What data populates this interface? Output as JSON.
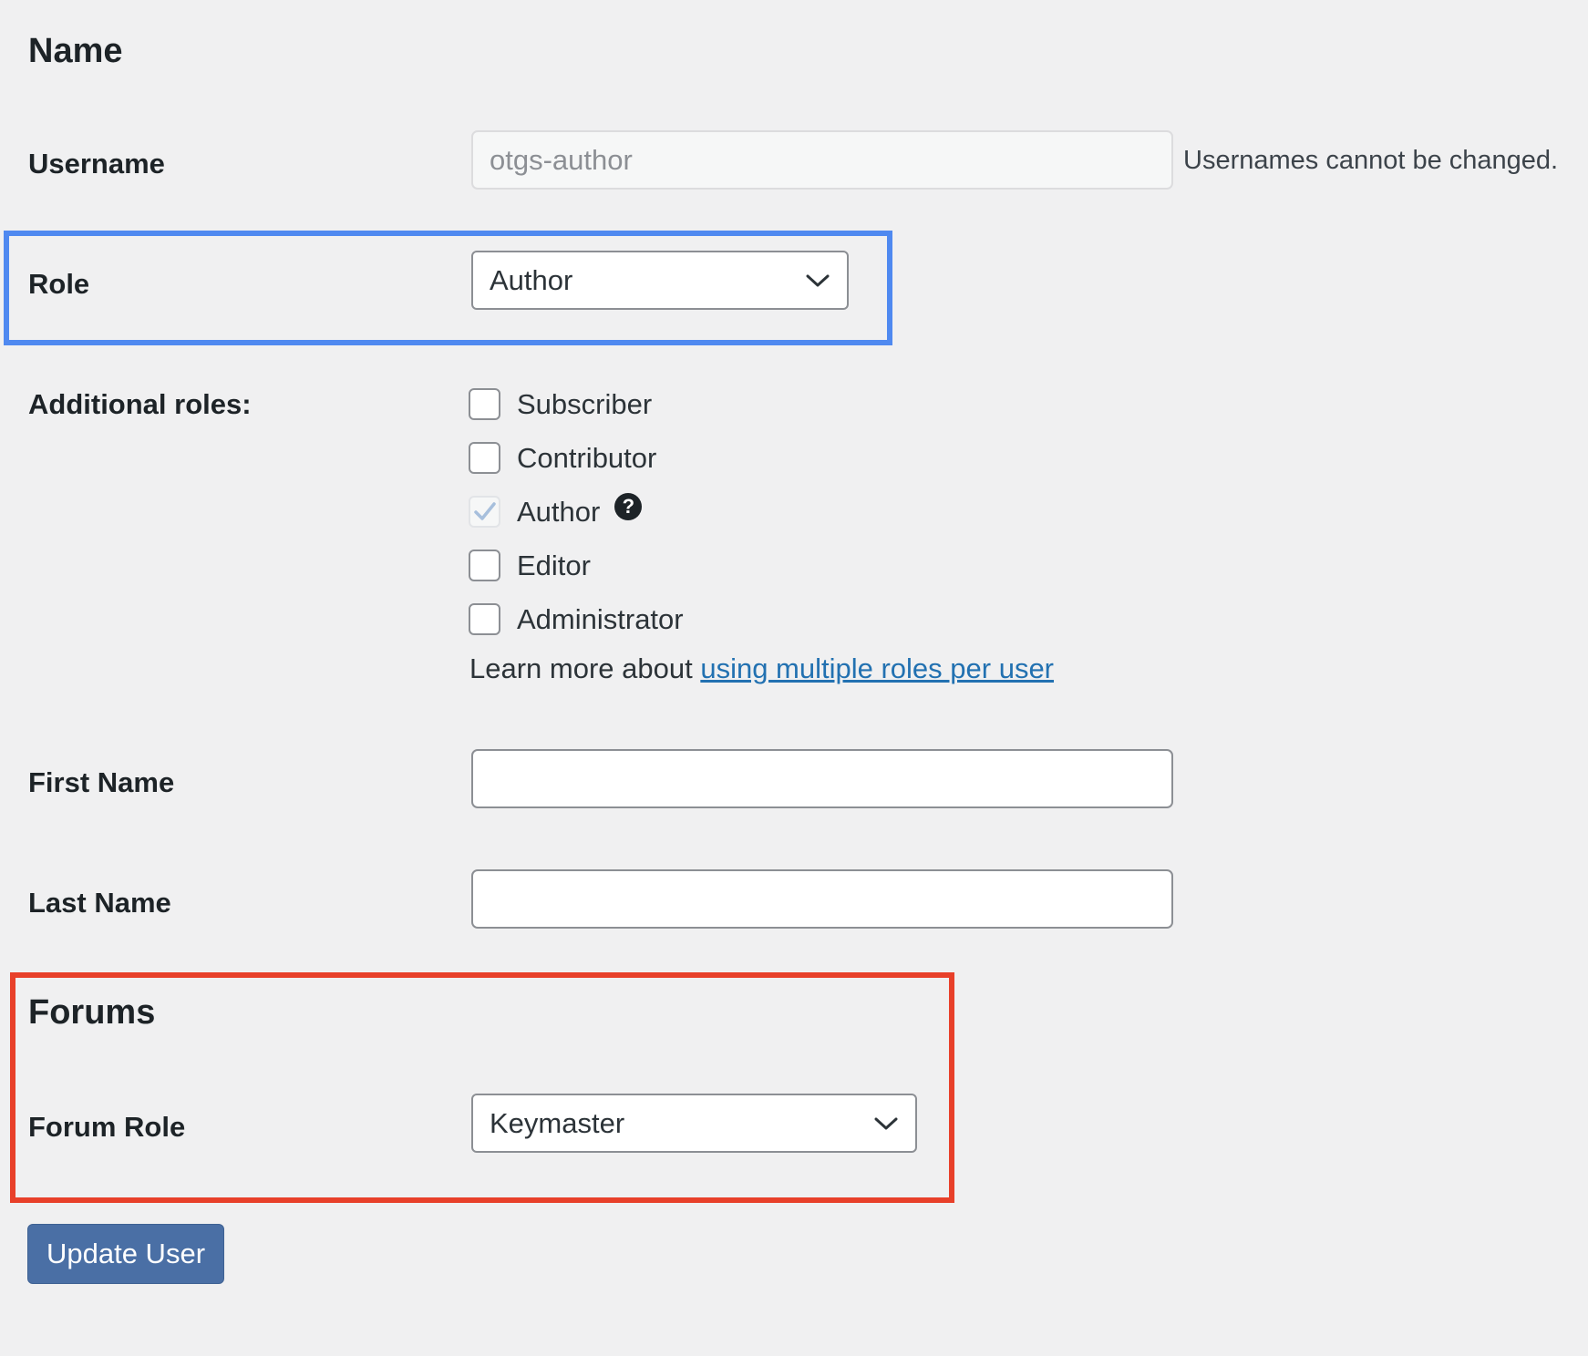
{
  "name_section": {
    "heading": "Name"
  },
  "username": {
    "label": "Username",
    "value": "otgs-author",
    "note": "Usernames cannot be changed."
  },
  "role": {
    "label": "Role",
    "selected": "Author",
    "icon": "chevron-down-icon"
  },
  "additional_roles": {
    "label": "Additional roles:",
    "options": [
      {
        "label": "Subscriber",
        "checked": false
      },
      {
        "label": "Contributor",
        "checked": false
      },
      {
        "label": "Author",
        "checked": true,
        "disabled": true
      },
      {
        "label": "Editor",
        "checked": false
      },
      {
        "label": "Administrator",
        "checked": false
      }
    ],
    "help_icon": "?",
    "learn_more_prefix": "Learn more about ",
    "learn_more_link": "using multiple roles per user"
  },
  "first_name": {
    "label": "First Name",
    "value": ""
  },
  "last_name": {
    "label": "Last Name",
    "value": ""
  },
  "forums_section": {
    "heading": "Forums",
    "forum_role_label": "Forum Role",
    "forum_role_selected": "Keymaster"
  },
  "actions": {
    "update_label": "Update User"
  },
  "colors": {
    "background": "#f0f0f1",
    "link": "#2271b1",
    "primary_button": "#4a6fa5",
    "highlight_blue": "#4f89f0",
    "highlight_red": "#e8402a"
  }
}
